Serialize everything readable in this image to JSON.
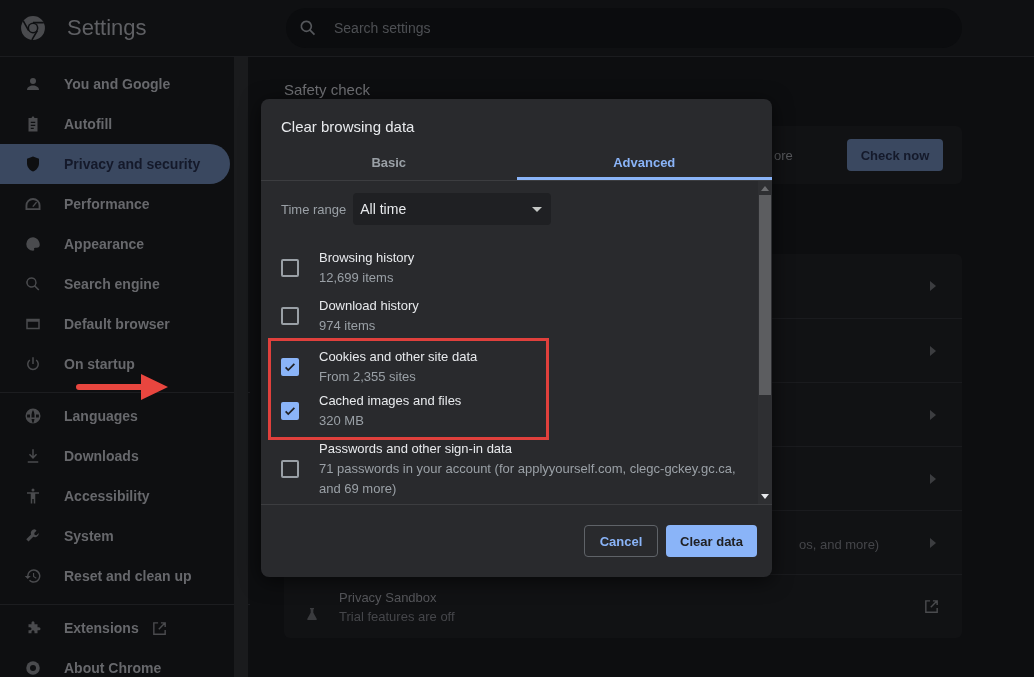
{
  "header": {
    "title": "Settings",
    "search": {
      "placeholder": "Search settings"
    }
  },
  "sidebar": {
    "groups": [
      {
        "items": [
          {
            "label": "You and Google",
            "selected": false
          },
          {
            "label": "Autofill",
            "selected": false
          },
          {
            "label": "Privacy and security",
            "selected": true
          },
          {
            "label": "Performance",
            "selected": false
          },
          {
            "label": "Appearance",
            "selected": false
          },
          {
            "label": "Search engine",
            "selected": false
          },
          {
            "label": "Default browser",
            "selected": false
          },
          {
            "label": "On startup",
            "selected": false
          }
        ]
      },
      {
        "items": [
          {
            "label": "Languages",
            "selected": false
          },
          {
            "label": "Downloads",
            "selected": false
          },
          {
            "label": "Accessibility",
            "selected": false
          },
          {
            "label": "System",
            "selected": false
          },
          {
            "label": "Reset and clean up",
            "selected": false
          }
        ]
      },
      {
        "items": [
          {
            "label": "Extensions",
            "selected": false
          },
          {
            "label": "About Chrome",
            "selected": false
          }
        ]
      }
    ]
  },
  "main": {
    "section_title": "Safety check",
    "safety_text": "ore",
    "check_button": "Check now",
    "rows": [
      {
        "kind": "arrow"
      },
      {
        "kind": "arrow"
      },
      {
        "kind": "arrow"
      },
      {
        "kind": "arrow"
      },
      {
        "kind": "arrow",
        "subtitle": "os, and more)"
      },
      {
        "kind": "external",
        "title": "Privacy Sandbox",
        "subtitle": "Trial features are off"
      }
    ]
  },
  "dialog": {
    "title": "Clear browsing data",
    "tabs": [
      {
        "label": "Basic",
        "selected": false
      },
      {
        "label": "Advanced",
        "selected": true
      }
    ],
    "time_range": {
      "label": "Time range",
      "value": "All time"
    },
    "items": [
      {
        "title": "Browsing history",
        "detail": "12,699 items",
        "checked": false,
        "highlighted": false
      },
      {
        "title": "Download history",
        "detail": "974 items",
        "checked": false,
        "highlighted": false
      },
      {
        "title": "Cookies and other site data",
        "detail": "From 2,355 sites",
        "checked": true,
        "highlighted": true
      },
      {
        "title": "Cached images and files",
        "detail": "320 MB",
        "checked": true,
        "highlighted": true
      },
      {
        "title": "Passwords and other sign-in data",
        "detail": "71 passwords in your account (for applyyourself.com, clegc-gckey.gc.ca, and 69 more)",
        "checked": false,
        "highlighted": false
      }
    ],
    "buttons": [
      {
        "label": "Cancel",
        "kind": "secondary"
      },
      {
        "label": "Clear data",
        "kind": "primary"
      }
    ]
  }
}
